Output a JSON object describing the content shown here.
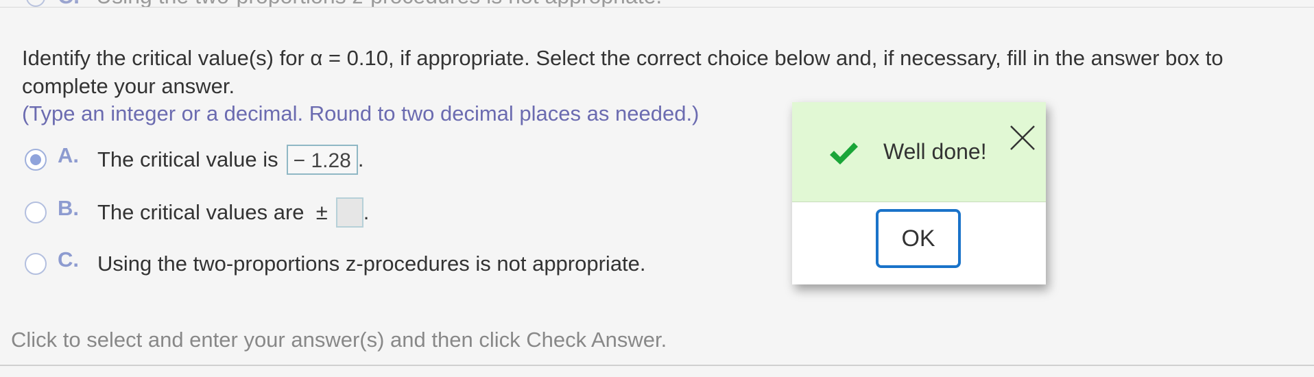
{
  "previous_choice": {
    "letter": "C.",
    "text": "Using the two-proportions z-procedures is not appropriate."
  },
  "question": {
    "prompt": "Identify the critical value(s) for α = 0.10, if appropriate. Select the correct choice below and, if necessary, fill in the answer box to complete your answer.",
    "hint": "(Type an integer or a decimal. Round to two decimal places as needed.)"
  },
  "choices": [
    {
      "letter": "A.",
      "text": "The critical value is",
      "answer": "− 1.28",
      "suffix": ".",
      "selected": true
    },
    {
      "letter": "B.",
      "text": "The critical values are  ±",
      "answer": "",
      "suffix": ".",
      "selected": false
    },
    {
      "letter": "C.",
      "text": "Using the two-proportions z-procedures is not appropriate.",
      "selected": false
    }
  ],
  "footer": {
    "instruction": "Click to select and enter your answer(s) and then click Check Answer."
  },
  "dialog": {
    "message": "Well done!",
    "ok_label": "OK",
    "icon": "checkmark-icon",
    "close_icon": "close-icon"
  },
  "colors": {
    "success_bg": "#e1f8d4",
    "check_green": "#1aa538",
    "ok_border": "#1a73c9",
    "choice_letter": "#8d9bd0",
    "hint_text": "#6b6bb0"
  }
}
